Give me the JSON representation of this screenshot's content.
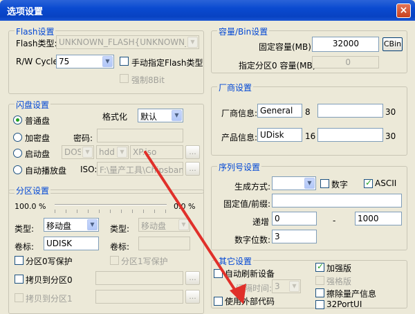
{
  "window": {
    "title": "选项设置",
    "close": "×"
  },
  "flash": {
    "title": "Flash设置",
    "type_label": "Flash类型:",
    "type_value": "UNKNOWN_FLASH{UNKNOWN_FLASH",
    "rw_label": "R/W Cycle:",
    "rw_value": "75",
    "manual_label": "手动指定Flash类型",
    "force8bit_label": "强制8Bit"
  },
  "capacity": {
    "title": "容量/Bin设置",
    "fixed_label": "固定容量(MB):",
    "fixed_value": "32000",
    "cbin": "CBin",
    "part0_label": "指定分区0 容量(MB):",
    "part0_value": "0"
  },
  "udisk": {
    "title": "闪盘设置",
    "normal": "普通盘",
    "format_label": "格式化",
    "format_value": "默认",
    "encrypted": "加密盘",
    "password_label": "密码:",
    "boot": "启动盘",
    "boot_os": "DOS",
    "boot_dev": "hdd",
    "boot_file": "XP.iso",
    "browse": "...",
    "autoplay": "自动播放盘",
    "iso_label": "ISO:",
    "iso_value": "F:\\量产工具\\Chipsbank\\C"
  },
  "vendor": {
    "title": "厂商设置",
    "vendor_label": "厂商信息:",
    "vendor_value": "General",
    "vendor_len": "8",
    "vendor_max": "30",
    "product_label": "产品信息:",
    "product_value": "UDisk",
    "product_len": "16",
    "product_max": "30"
  },
  "partition": {
    "title": "分区设置",
    "percent_left": "100.0 %",
    "percent_right": "0.0 %",
    "type_label": "类型:",
    "type_value": "移动盘",
    "type2_label": "类型:",
    "type2_value": "移动盘",
    "vol_label": "卷标:",
    "vol_value": "UDISK",
    "vol2_label": "卷标:",
    "wp0": "分区0写保护",
    "wp1": "分区1写保护",
    "copy0": "拷贝到分区0",
    "copy1": "拷贝到分区1",
    "browse": "..."
  },
  "serial": {
    "title": "序列号设置",
    "mode_label": "生成方式:",
    "digit_label": "数字",
    "ascii_label": "ASCII",
    "prefix_label": "固定值/前缀:",
    "incr_label": "递增",
    "incr_from": "0",
    "dash": "-",
    "incr_to": "1000",
    "digits_label": "数字位数:",
    "digits_value": "3"
  },
  "other": {
    "title": "其它设置",
    "auto_refresh": "自动刷新设备",
    "enhanced": "加强版",
    "interval_label": "间隔时间:",
    "interval_value": "3",
    "strong": "强格版",
    "ext_code": "使用外部代码",
    "erase_info": "擦除量产信息",
    "port": "32PortUI"
  },
  "colors": {
    "titlebar": "#0a4ad0",
    "group_title": "#0046d5",
    "arrow": "#e0302a"
  }
}
